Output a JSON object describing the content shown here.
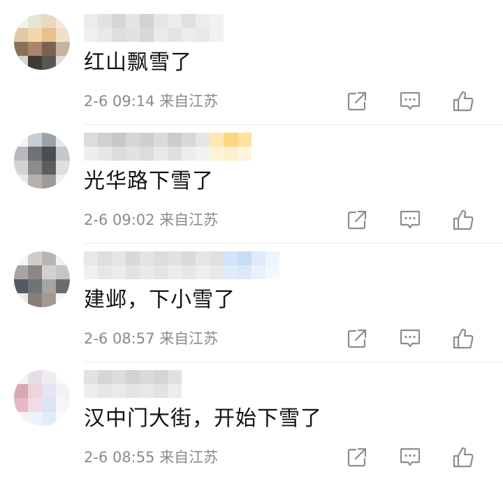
{
  "comments": [
    {
      "text": "红山飘雪了",
      "date": "2-6 09:14",
      "location": "来自江苏",
      "avatar": [
        "#f2f2ef",
        "#e4e4d8",
        "#e8d9c0",
        "#f4e9d8",
        "#e0c9a8",
        "#f2d8a8",
        "#e8c08e",
        "#f0e0c8",
        "#8a7058",
        "#a8846a",
        "#7a6350",
        "#c4b4a4",
        "#d4d4d0",
        "#3e3a36",
        "#5a5650",
        "#e0dcd8"
      ],
      "name_mosaic": [
        [
          "#ececec",
          "#e2e2e2",
          "#d6d6d6",
          "#e4e4e4",
          "#d2d2d2",
          "#e6e6e6",
          "#ececec",
          "#e0e0e0",
          "#ececec",
          "#f2f2f2"
        ],
        [
          "#f0f0f0",
          "#e8e8e8",
          "#dedede",
          "#e2e2e2",
          "#d8d8d8",
          "#eaeaea",
          "#e4e4e4",
          "#ececec",
          "#e8e8e8",
          "#f2f2f2"
        ]
      ]
    },
    {
      "text": "光华路下雪了",
      "date": "2-6 09:02",
      "location": "来自江苏",
      "avatar": [
        "#f4f4f4",
        "#c8cdd2",
        "#9aa2aa",
        "#e4e6e8",
        "#b8babc",
        "#6e7276",
        "#4a4e52",
        "#c6c8ca",
        "#d2d2d0",
        "#8a8c8a",
        "#5c5e5e",
        "#dedfe0",
        "#e8e8e8",
        "#b4b0ac",
        "#9e9a96",
        "#f0f0f0"
      ],
      "name_mosaic": [
        [
          "#dcdcdc",
          "#d0d0d0",
          "#c8c8c8",
          "#d6d6d6",
          "#cfcfcf",
          "#dadada",
          "#cccccc",
          "#d8d8d8",
          "#e6e6e6",
          "#ffe9b0",
          "#fcd680",
          "#fde2a0"
        ],
        [
          "#eeeeee",
          "#e6e6e6",
          "#dcdcdc",
          "#e2e2e2",
          "#dcdcdc",
          "#e8e8e8",
          "#e0e0e0",
          "#ececec",
          "#f2f2f2",
          "#fff3d8",
          "#fff0cc",
          "#fff4dc"
        ]
      ]
    },
    {
      "text": "建邺，下小雪了",
      "date": "2-6 08:57",
      "location": "来自江苏",
      "avatar": [
        "#f4f4f4",
        "#d0ccca",
        "#b8b4b2",
        "#eeeeee",
        "#a8a4a4",
        "#8c8686",
        "#d4d0d0",
        "#c4c4c4",
        "#545a60",
        "#707478",
        "#a8a4a0",
        "#6a6c6e",
        "#eceae8",
        "#8a7e7a",
        "#a49894",
        "#f6f6f6"
      ],
      "name_mosaic": [
        [
          "#e8e8e8",
          "#dedede",
          "#e6e6e6",
          "#d8d8d8",
          "#e4e4e4",
          "#dcdcdc",
          "#e2e2e2",
          "#dadada",
          "#e6e6e6",
          "#e0e0e0",
          "#d4e4f8",
          "#c8dcf6",
          "#dfeafa",
          "#eef4fc"
        ],
        [
          "#f0f0f0",
          "#e6e6e6",
          "#ececec",
          "#e2e2e2",
          "#eaeaea",
          "#e4e4e4",
          "#ececec",
          "#e6e6e6",
          "#eeeeee",
          "#e8e8e8",
          "#e0ecfa",
          "#dbe8f8",
          "#eaf1fc",
          "#f4f8fd"
        ]
      ]
    },
    {
      "text": "汉中门大街，开始下雪了",
      "date": "2-6 08:55",
      "location": "来自江苏",
      "avatar": [
        "#f6f2f6",
        "#e8dce8",
        "#f0eaf2",
        "#fafafa",
        "#d8a8b4",
        "#ecd4dc",
        "#e6e4f0",
        "#f2f2f6",
        "#e8b8c8",
        "#f2dce4",
        "#dce4f4",
        "#f4f6fa",
        "#f8f0f4",
        "#eef2fa",
        "#e2ecf8",
        "#fbfbfd"
      ],
      "name_mosaic": [
        [
          "#e2e2e2",
          "#d6d6d6",
          "#dcdcdc",
          "#d2d2d2",
          "#dadada",
          "#d4d4d4",
          "#e0e0e0"
        ],
        [
          "#eeeeee",
          "#e6e6e6",
          "#eaeaea",
          "#e4e4e4",
          "#e8e8e8",
          "#e2e2e2",
          "#ececec"
        ]
      ]
    }
  ],
  "icons": {
    "share": "share-icon",
    "reply": "comment-icon",
    "like": "like-icon",
    "stroke_color": "#8c8c8c"
  }
}
